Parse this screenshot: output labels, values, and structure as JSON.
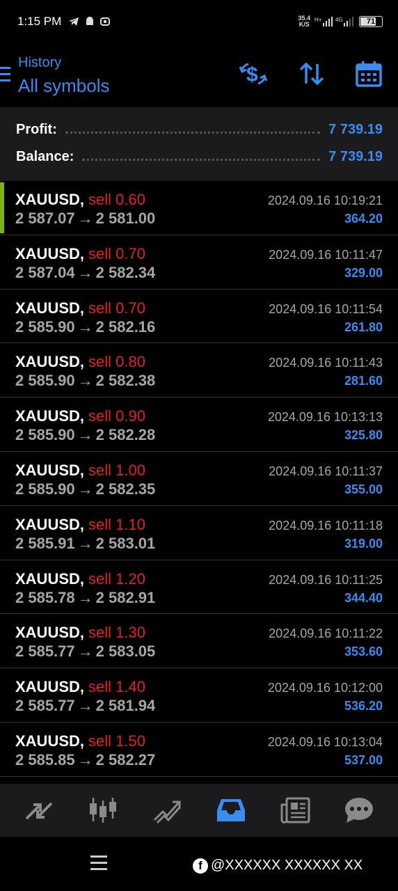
{
  "status_bar": {
    "time": "1:15 PM",
    "net_speed_value": "35.4",
    "net_speed_unit": "K/S",
    "signal_text": "H+ 4G",
    "battery": "71"
  },
  "header": {
    "title": "History",
    "subtitle": "All symbols"
  },
  "summary": {
    "profit_label": "Profit:",
    "profit_value": "7 739.19",
    "balance_label": "Balance:",
    "balance_value": "7 739.19"
  },
  "deals": [
    {
      "symbol": "XAUUSD,",
      "side": "sell 0.60",
      "open": "2 587.07",
      "close": "2 581.00",
      "time": "2024.09.16 10:19:21",
      "profit": "364.20"
    },
    {
      "symbol": "XAUUSD,",
      "side": "sell 0.70",
      "open": "2 587.04",
      "close": "2 582.34",
      "time": "2024.09.16 10:11:47",
      "profit": "329.00"
    },
    {
      "symbol": "XAUUSD,",
      "side": "sell 0.70",
      "open": "2 585.90",
      "close": "2 582.16",
      "time": "2024.09.16 10:11:54",
      "profit": "261.80"
    },
    {
      "symbol": "XAUUSD,",
      "side": "sell 0.80",
      "open": "2 585.90",
      "close": "2 582.38",
      "time": "2024.09.16 10:11:43",
      "profit": "281.60"
    },
    {
      "symbol": "XAUUSD,",
      "side": "sell 0.90",
      "open": "2 585.90",
      "close": "2 582.28",
      "time": "2024.09.16 10:13:13",
      "profit": "325.80"
    },
    {
      "symbol": "XAUUSD,",
      "side": "sell 1.00",
      "open": "2 585.90",
      "close": "2 582.35",
      "time": "2024.09.16 10:11:37",
      "profit": "355.00"
    },
    {
      "symbol": "XAUUSD,",
      "side": "sell 1.10",
      "open": "2 585.91",
      "close": "2 583.01",
      "time": "2024.09.16 10:11:18",
      "profit": "319.00"
    },
    {
      "symbol": "XAUUSD,",
      "side": "sell 1.20",
      "open": "2 585.78",
      "close": "2 582.91",
      "time": "2024.09.16 10:11:25",
      "profit": "344.40"
    },
    {
      "symbol": "XAUUSD,",
      "side": "sell 1.30",
      "open": "2 585.77",
      "close": "2 583.05",
      "time": "2024.09.16 10:11:22",
      "profit": "353.60"
    },
    {
      "symbol": "XAUUSD,",
      "side": "sell 1.40",
      "open": "2 585.77",
      "close": "2 581.94",
      "time": "2024.09.16 10:12:00",
      "profit": "536.20"
    },
    {
      "symbol": "XAUUSD,",
      "side": "sell 1.50",
      "open": "2 585.85",
      "close": "2 582.27",
      "time": "2024.09.16 10:13:04",
      "profit": "537.00"
    }
  ],
  "nav_items": [
    "quotes-icon",
    "chart-icon",
    "trade-icon",
    "history-icon",
    "news-icon",
    "messages-icon"
  ],
  "watermark": {
    "text": "@XXXXXX XXXXXX XX"
  },
  "colors": {
    "accent": "#3b8cf0",
    "sell": "#e02424",
    "selected_marker": "#7fb21c"
  }
}
